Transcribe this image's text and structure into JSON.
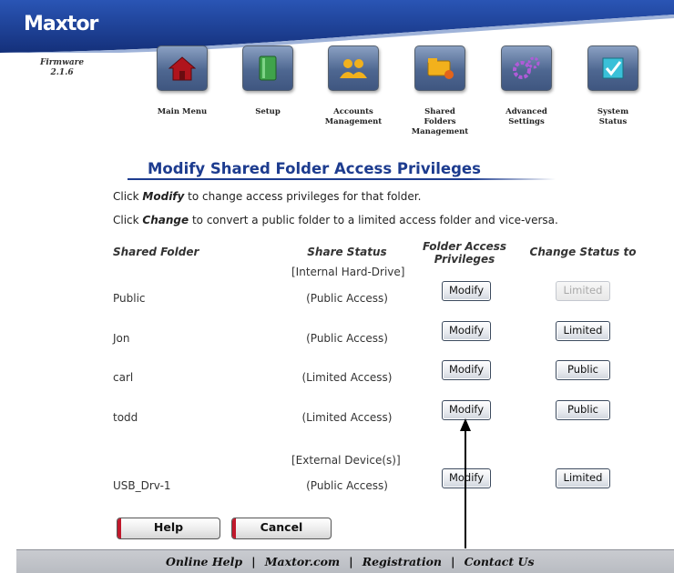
{
  "brand": {
    "logo": "Maxtor",
    "firmware_label": "Firmware",
    "firmware_version": "2.1.6"
  },
  "nav": [
    {
      "label_lines": [
        "Main Menu"
      ],
      "icon": "house-icon"
    },
    {
      "label_lines": [
        "Setup"
      ],
      "icon": "setup-book-icon"
    },
    {
      "label_lines": [
        "Accounts",
        "Management"
      ],
      "icon": "users-icon"
    },
    {
      "label_lines": [
        "Shared",
        "Folders",
        "Management"
      ],
      "icon": "shared-folders-icon"
    },
    {
      "label_lines": [
        "Advanced",
        "Settings"
      ],
      "icon": "gears-icon"
    },
    {
      "label_lines": [
        "System",
        "Status"
      ],
      "icon": "checkmark-icon"
    }
  ],
  "page": {
    "title": "Modify Shared Folder Access Privileges",
    "instruction1": {
      "prefix": "Click ",
      "keyword": "Modify",
      "suffix": " to change access privileges for that folder."
    },
    "instruction2": {
      "prefix": "Click ",
      "keyword": "Change",
      "suffix": " to convert a public folder to a limited access folder and vice-versa."
    }
  },
  "table": {
    "headers": {
      "folder": "Shared Folder",
      "status": "Share Status",
      "privileges": [
        "Folder Access",
        "Privileges"
      ],
      "change": "Change Status to"
    },
    "groups": [
      {
        "label": "[Internal Hard-Drive]",
        "rows": [
          {
            "folder": "Public",
            "status": "(Public Access)",
            "modify": "Modify",
            "change": "Limited",
            "change_enabled": false
          },
          {
            "folder": "Jon",
            "status": "(Public Access)",
            "modify": "Modify",
            "change": "Limited",
            "change_enabled": true
          },
          {
            "folder": "carl",
            "status": "(Limited Access)",
            "modify": "Modify",
            "change": "Public",
            "change_enabled": true
          },
          {
            "folder": "todd",
            "status": "(Limited Access)",
            "modify": "Modify",
            "change": "Public",
            "change_enabled": true
          }
        ]
      },
      {
        "label": "[External Device(s)]",
        "rows": [
          {
            "folder": "USB_Drv-1",
            "status": "(Public Access)",
            "modify": "Modify",
            "change": "Limited",
            "change_enabled": true
          }
        ]
      }
    ]
  },
  "buttons": {
    "help": "Help",
    "cancel": "Cancel"
  },
  "footer": {
    "links": [
      "Online Help",
      "Maxtor.com",
      "Registration",
      "Contact Us"
    ],
    "separator": "|"
  },
  "colors": {
    "header_blue": "#1b3f96",
    "title_blue": "#1d3c8f",
    "accent_red": "#c0182b"
  }
}
